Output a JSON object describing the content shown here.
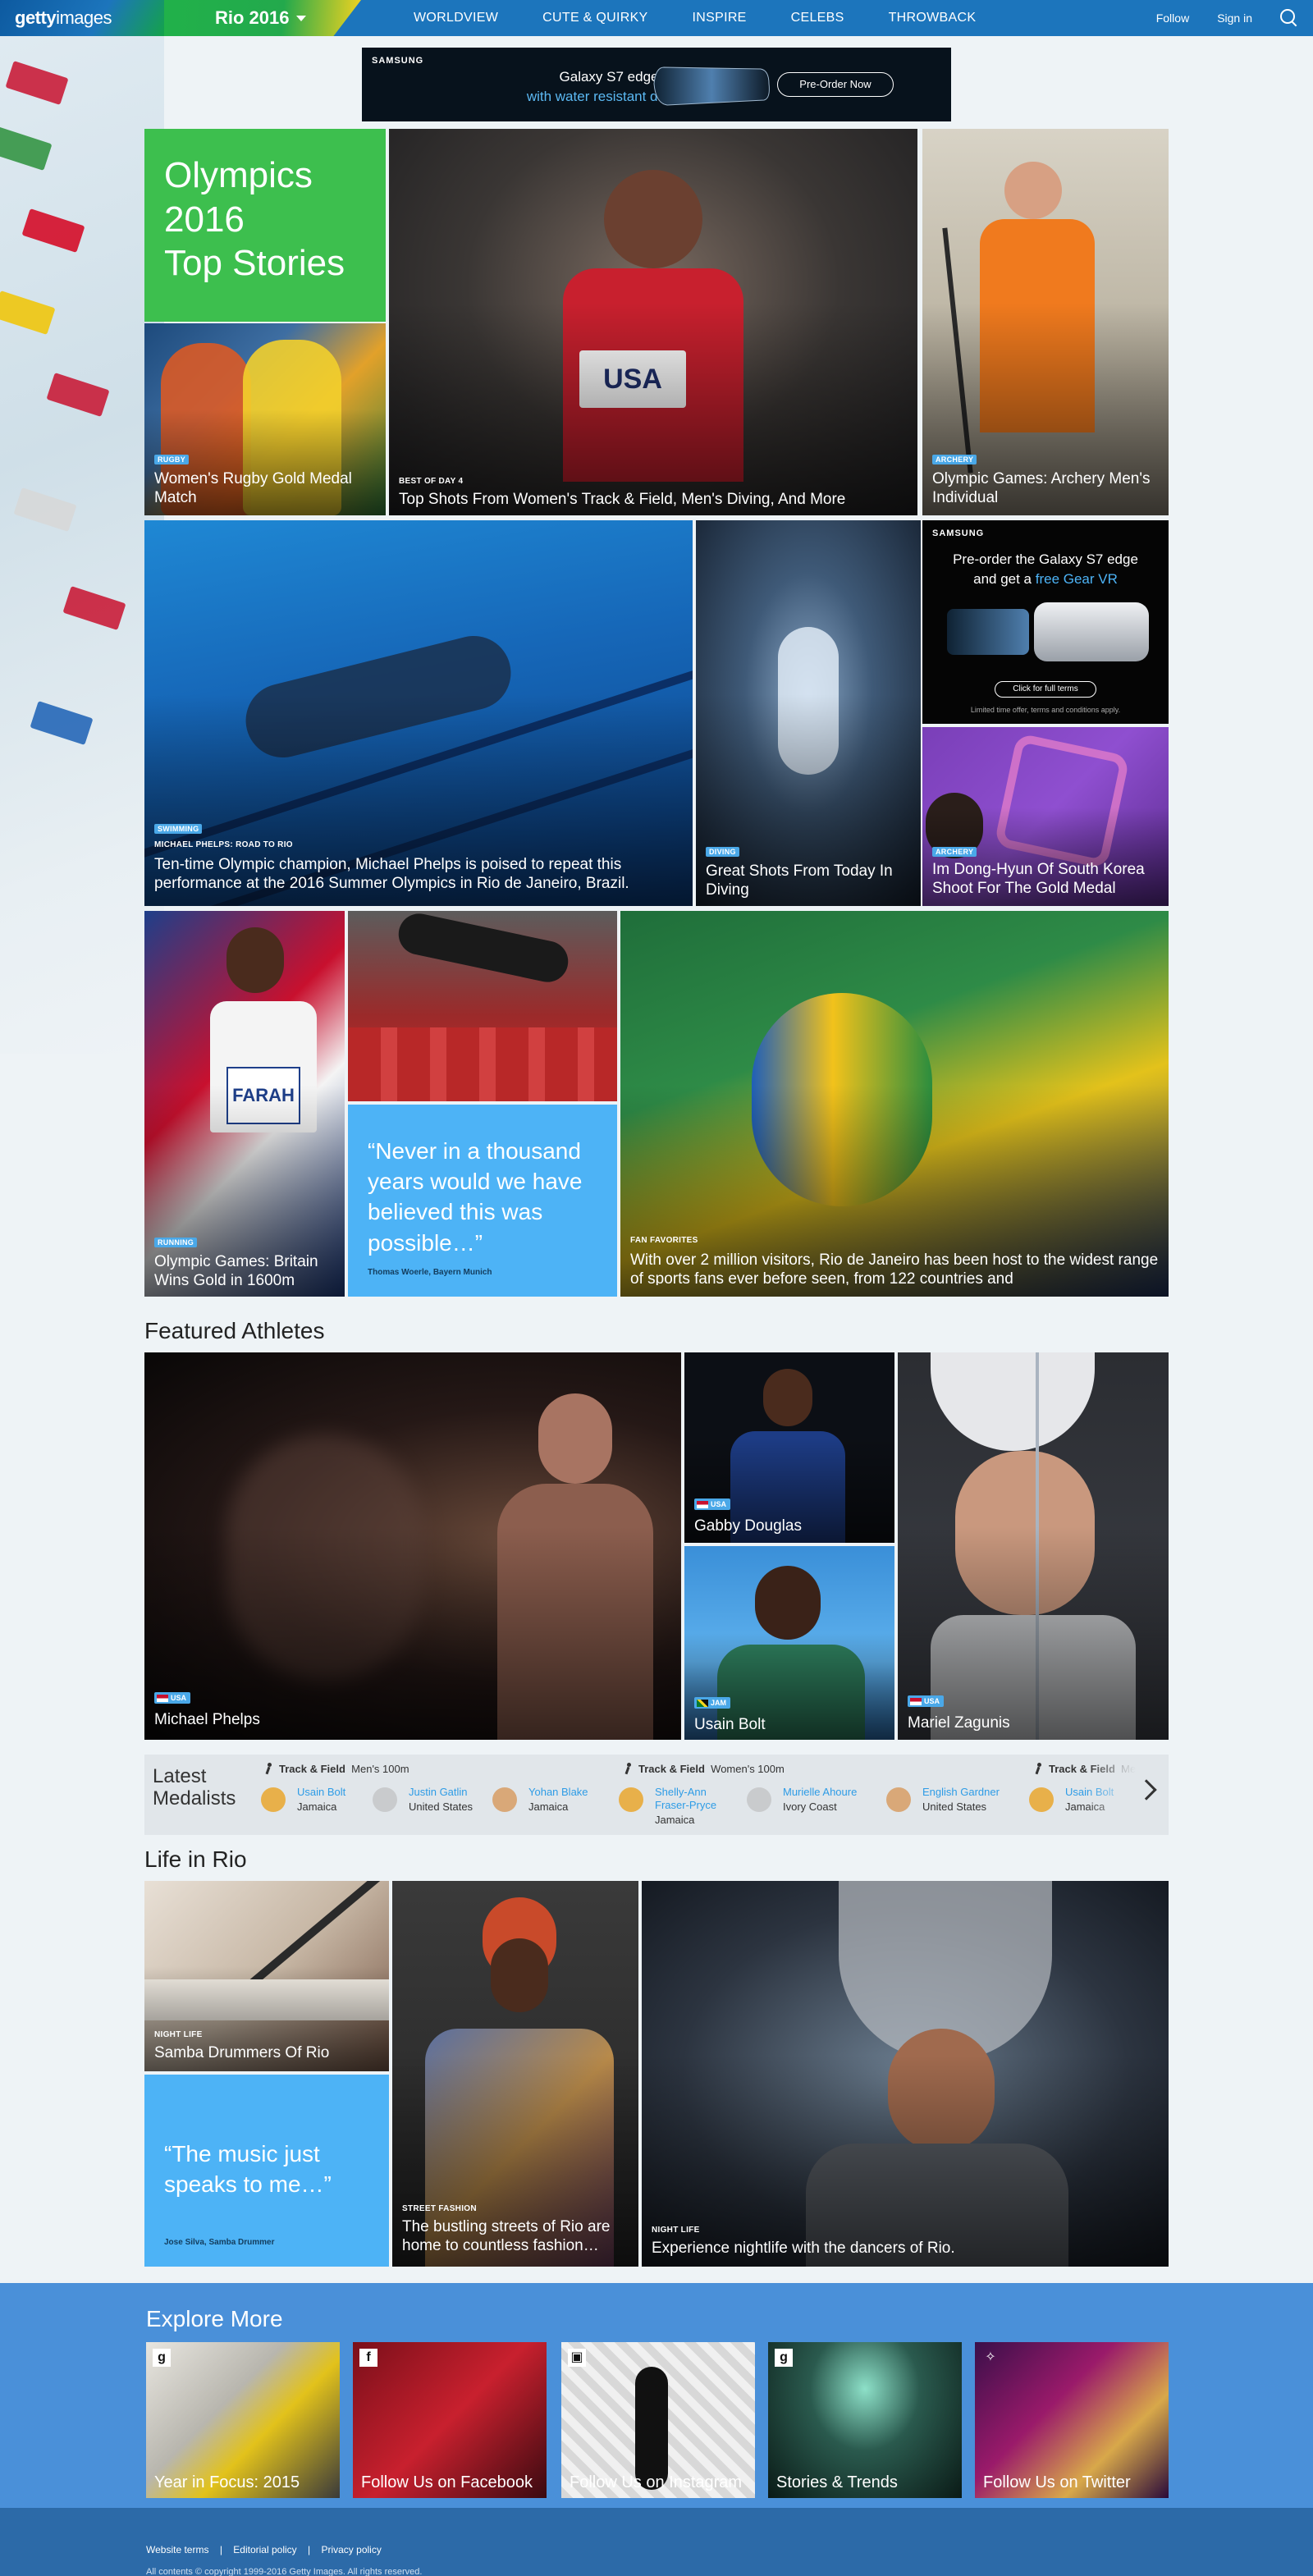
{
  "nav": {
    "logo_bold": "getty",
    "logo_light": "images",
    "section": "Rio 2016",
    "links": [
      "WORLDVIEW",
      "CUTE & QUIRKY",
      "INSPIRE",
      "CELEBS",
      "THROWBACK"
    ],
    "follow": "Follow",
    "sign_in": "Sign in"
  },
  "ad_top": {
    "brand": "SAMSUNG",
    "line1": "Galaxy S7 edge",
    "line2": "with water resistant design",
    "cta": "Pre-Order Now"
  },
  "hero": {
    "line1": "Olympics",
    "line2": "2016",
    "line3": "Top Stories"
  },
  "stories": {
    "rugby": {
      "tag": "RUGBY",
      "title": "Women's Rugby Gold Medal Match"
    },
    "best_of_day": {
      "tag": "BEST OF DAY 4",
      "title": "Top Shots From Women's Track & Field, Men's Diving, And More"
    },
    "archery_men": {
      "tag": "ARCHERY",
      "title": "Olympic Games: Archery Men's Individual"
    },
    "phelps": {
      "tag": "SWIMMING",
      "subtag": "MICHAEL PHELPS: ROAD TO RIO",
      "title": "Ten-time Olympic champion, Michael Phelps is poised to repeat this performance at the 2016 Summer Olympics in Rio de Janeiro, Brazil."
    },
    "diving": {
      "tag": "DIVING",
      "title": "Great Shots From Today In Diving"
    },
    "archery_korea": {
      "tag": "ARCHERY",
      "title": "Im Dong-Hyun Of South Korea Shoot For The Gold Medal"
    },
    "running": {
      "tag": "RUNNING",
      "title": "Olympic Games: Britain Wins Gold in 1600m"
    },
    "fans": {
      "tag": "FAN FAVORITES",
      "title": "With over 2 million visitors, Rio de Janeiro has been host to the widest range of sports fans ever before seen, from 122 countries and"
    }
  },
  "ad_side": {
    "brand": "SAMSUNG",
    "line1": "Pre-order the Galaxy S7 edge",
    "line2a": "and get a ",
    "line2b": "free Gear VR",
    "cta": "Click for full terms",
    "fine": "Limited time offer, terms and conditions apply."
  },
  "quote1": {
    "text": "“Never in a thousand years would we have believed this was possible…”",
    "who": "Thomas Woerle, Bayern Munich"
  },
  "featured": {
    "heading": "Featured Athletes",
    "athletes": [
      {
        "name": "Michael Phelps",
        "country": "USA"
      },
      {
        "name": "Gabby Douglas",
        "country": "USA"
      },
      {
        "name": "Usain Bolt",
        "country": "JAM"
      },
      {
        "name": "Mariel Zagunis",
        "country": "USA"
      }
    ]
  },
  "medalists": {
    "heading_1": "Latest",
    "heading_2": "Medalists",
    "events": [
      {
        "sport": "Track & Field",
        "event": "Men's 100m",
        "medals": [
          {
            "name": "Usain Bolt",
            "country": "Jamaica",
            "color": "#e8b04a"
          },
          {
            "name": "Justin Gatlin",
            "country": "United States",
            "color": "#c9cbcd"
          },
          {
            "name": "Yohan Blake",
            "country": "Jamaica",
            "color": "#d9a878"
          }
        ]
      },
      {
        "sport": "Track & Field",
        "event": "Women's 100m",
        "medals": [
          {
            "name": "Shelly-Ann Fraser-Pryce",
            "country": "Jamaica",
            "color": "#e8b04a"
          },
          {
            "name": "Murielle Ahoure",
            "country": "Ivory Coast",
            "color": "#c9cbcd"
          },
          {
            "name": "English Gardner",
            "country": "United States",
            "color": "#d9a878"
          }
        ]
      },
      {
        "sport": "Track & Field",
        "event": "Me",
        "medals": [
          {
            "name": "Usain Bolt",
            "country": "Jamaica",
            "color": "#e8b04a"
          }
        ]
      }
    ]
  },
  "life": {
    "heading": "Life in Rio",
    "samba": {
      "tag": "NIGHT LIFE",
      "title": "Samba Drummers Of Rio"
    },
    "quote": {
      "text": "“The music just speaks to me…”",
      "who": "Jose Silva, Samba Drummer"
    },
    "fashion": {
      "tag": "STREET FASHION",
      "title": "The bustling streets of Rio are home to countless fashion…"
    },
    "nightlife": {
      "tag": "NIGHT LIFE",
      "title": "Experience nightlife with the dancers of Rio."
    }
  },
  "explore": {
    "heading": "Explore More",
    "cards": [
      {
        "label": "Year in Focus: 2015",
        "icon": "g"
      },
      {
        "label": "Follow Us on Facebook",
        "icon": "f"
      },
      {
        "label": "Follow Us on Instagram",
        "icon": "▣"
      },
      {
        "label": "Stories & Trends",
        "icon": "g"
      },
      {
        "label": "Follow Us on Twitter",
        "icon": "✧"
      }
    ]
  },
  "footer": {
    "links": [
      "Website terms",
      "|",
      "Editorial policy",
      "|",
      "Privacy policy"
    ],
    "copyright": "All contents © copyright 1999-2016 Getty Images. All rights reserved."
  }
}
